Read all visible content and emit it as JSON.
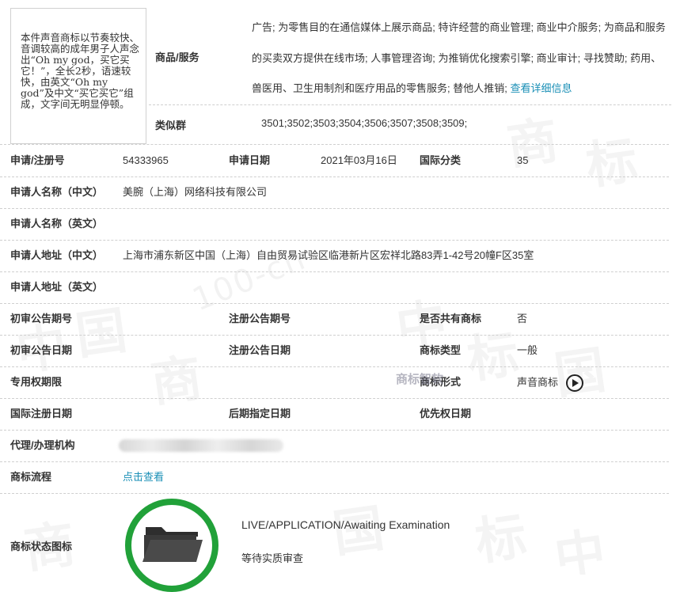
{
  "watermark": {
    "glyphs": [
      "商",
      "标",
      "中",
      "国",
      "商",
      "标",
      "中",
      "国",
      "商",
      "标",
      "中",
      "国"
    ],
    "url": "100-ch"
  },
  "sound_description": "本件声音商标以节奏较快、音调较高的成年男子人声念出“Oh my god，买它买它！”，全长2秒，语速较快，由英文“Oh my god”及中文“买它买它”组成，文字间无明显停顿。",
  "goods": {
    "label": "商品/服务",
    "text": "广告; 为零售目的在通信媒体上展示商品; 特许经营的商业管理; 商业中介服务; 为商品和服务的买卖双方提供在线市场; 人事管理咨询; 为推销优化搜索引擎; 商业审计; 寻找赞助; 药用、兽医用、卫生用制剂和医疗用品的零售服务; 替他人推销;",
    "more_link": "查看详细信息"
  },
  "similar_group": {
    "label": "类似群",
    "value": "3501;3502;3503;3504;3506;3507;3508;3509;"
  },
  "rows": {
    "reg_no": {
      "label": "申请/注册号",
      "value": "54333965"
    },
    "app_date": {
      "label": "申请日期",
      "value": "2021年03月16日"
    },
    "intl_class": {
      "label": "国际分类",
      "value": "35"
    },
    "applicant_cn": {
      "label": "申请人名称（中文）",
      "value": "美腕（上海）网络科技有限公司"
    },
    "applicant_en": {
      "label": "申请人名称（英文）",
      "value": ""
    },
    "address_cn": {
      "label": "申请人地址（中文）",
      "value": "上海市浦东新区中国（上海）自由贸易试验区临港新片区宏祥北路83弄1-42号20幢F区35室"
    },
    "address_en": {
      "label": "申请人地址（英文）",
      "value": ""
    },
    "prelim_no": {
      "label": "初审公告期号",
      "value": ""
    },
    "reg_pub_no": {
      "label": "注册公告期号",
      "value": ""
    },
    "shared": {
      "label": "是否共有商标",
      "value": "否"
    },
    "prelim_date": {
      "label": "初审公告日期",
      "value": ""
    },
    "reg_pub_date": {
      "label": "注册公告日期",
      "value": ""
    },
    "tm_type": {
      "label": "商标类型",
      "value": "一般"
    },
    "exclusive_period": {
      "label": "专用权期限",
      "value": ""
    },
    "tm_form": {
      "label": "商标形式",
      "value": "声音商标"
    },
    "intl_reg_date": {
      "label": "国际注册日期",
      "value": ""
    },
    "later_date": {
      "label": "后期指定日期",
      "value": ""
    },
    "priority_date": {
      "label": "优先权日期",
      "value": ""
    },
    "agent": {
      "label": "代理/办理机构",
      "value": ""
    },
    "process": {
      "label": "商标流程",
      "link": "点击查看"
    },
    "status_icon": {
      "label": "商标状态图标"
    }
  },
  "logo_watermark": "商标智软",
  "status": {
    "en": "LIVE/APPLICATION/Awaiting Examination",
    "cn": "等待实质审查"
  },
  "colors": {
    "link": "#1a8fb6",
    "status_ring": "#21a139",
    "folder": "#3a3a3a"
  },
  "icons": {
    "play": "play-circle-icon",
    "folder": "folder-icon"
  }
}
